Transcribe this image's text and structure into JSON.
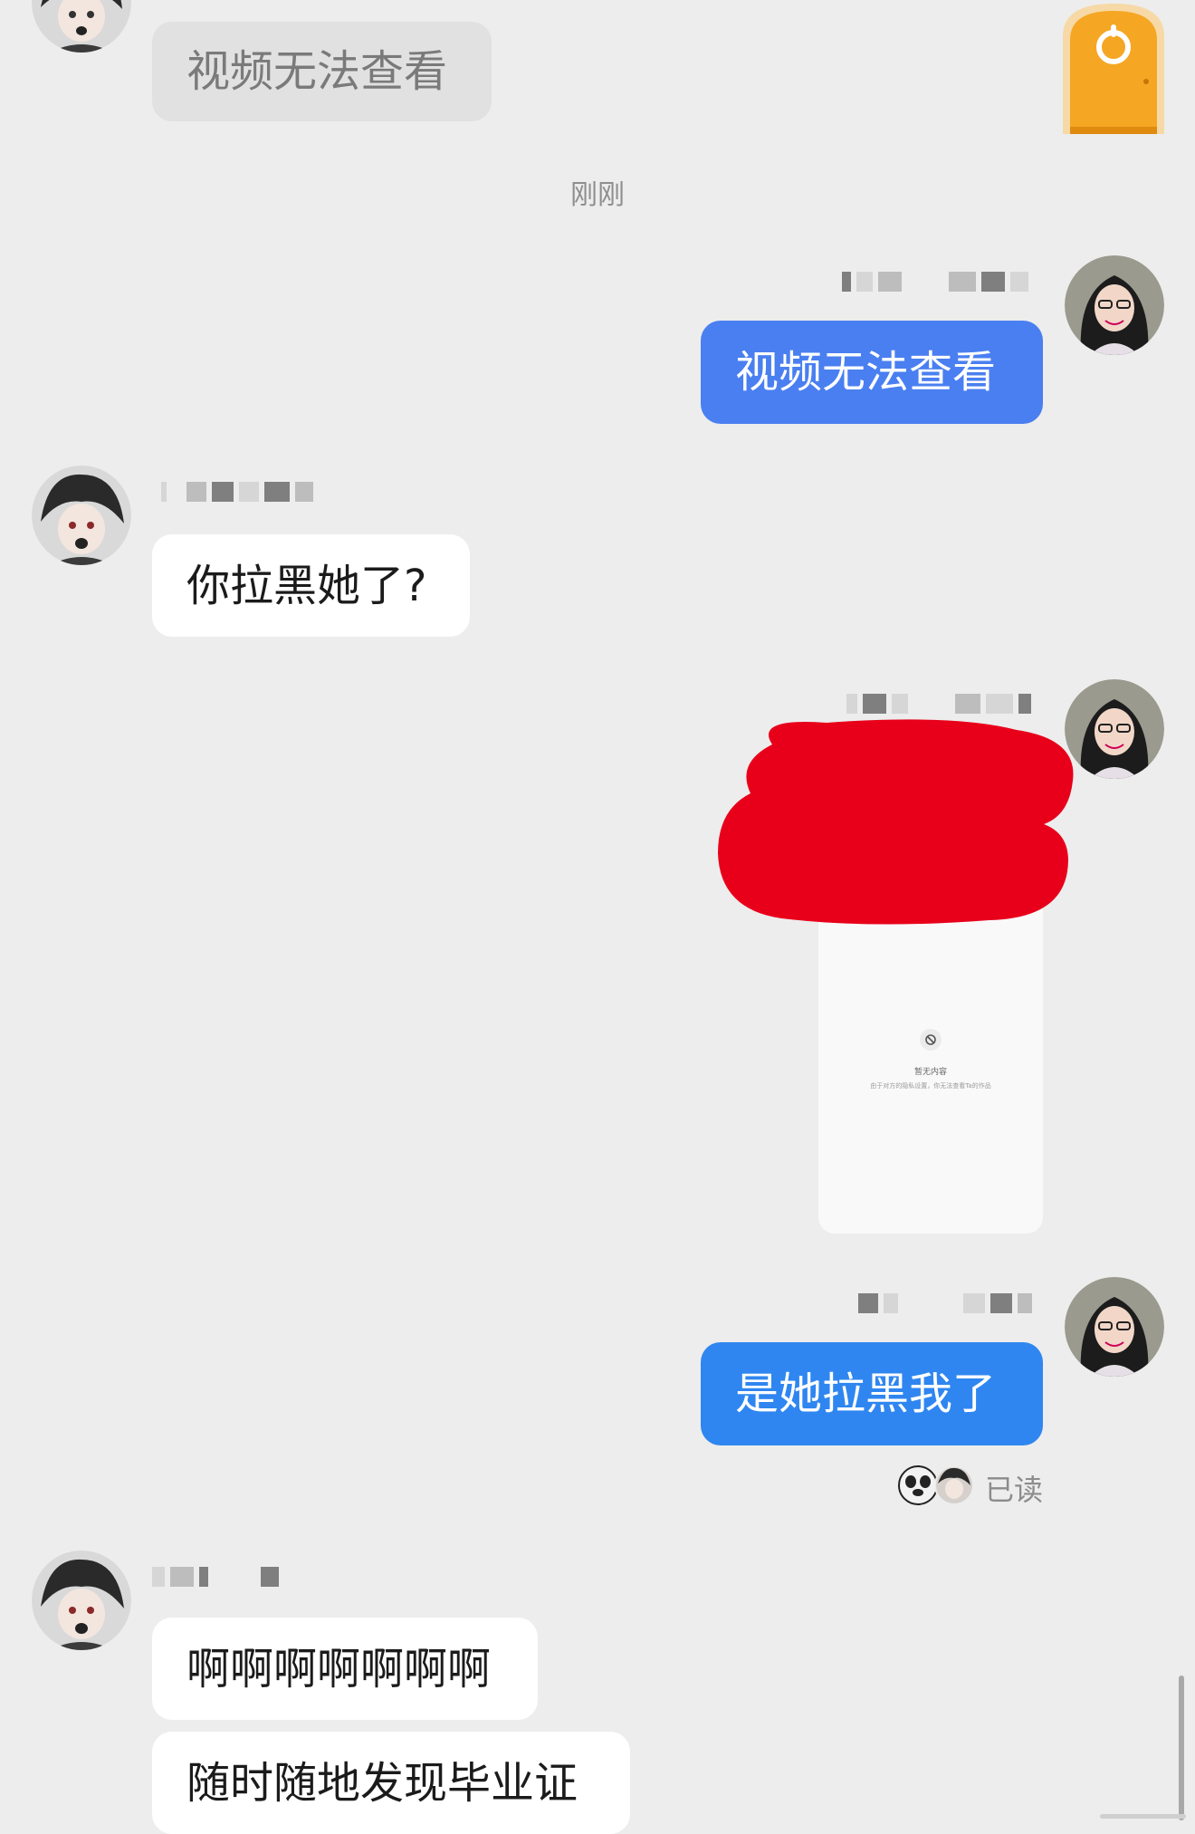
{
  "messages": {
    "m1": {
      "text": "视频无法查看"
    },
    "timestamp": "刚刚",
    "m2": {
      "text": "视频无法查看"
    },
    "m3": {
      "text": "你拉黑她了?"
    },
    "video": {
      "title": "暂无内容",
      "desc": "由于对方的隐私设置，你无法查看Ta的作品"
    },
    "m4": {
      "text": "是她拉黑我了"
    },
    "read": "已读",
    "m5": {
      "text": "啊啊啊啊啊啊啊"
    },
    "m6": {
      "text": "随时随地发现毕业证"
    }
  },
  "colors": {
    "background": "#ededed",
    "incoming_bubble": "#ffffff",
    "outgoing_bubble": "#2f86f0",
    "outgoing_bubble_alt": "#4a7ff1",
    "redaction": "#e8001a",
    "door": "#f5a623"
  },
  "icons": {
    "door": "door-entrance-icon",
    "blocked": "prohibited-icon"
  }
}
